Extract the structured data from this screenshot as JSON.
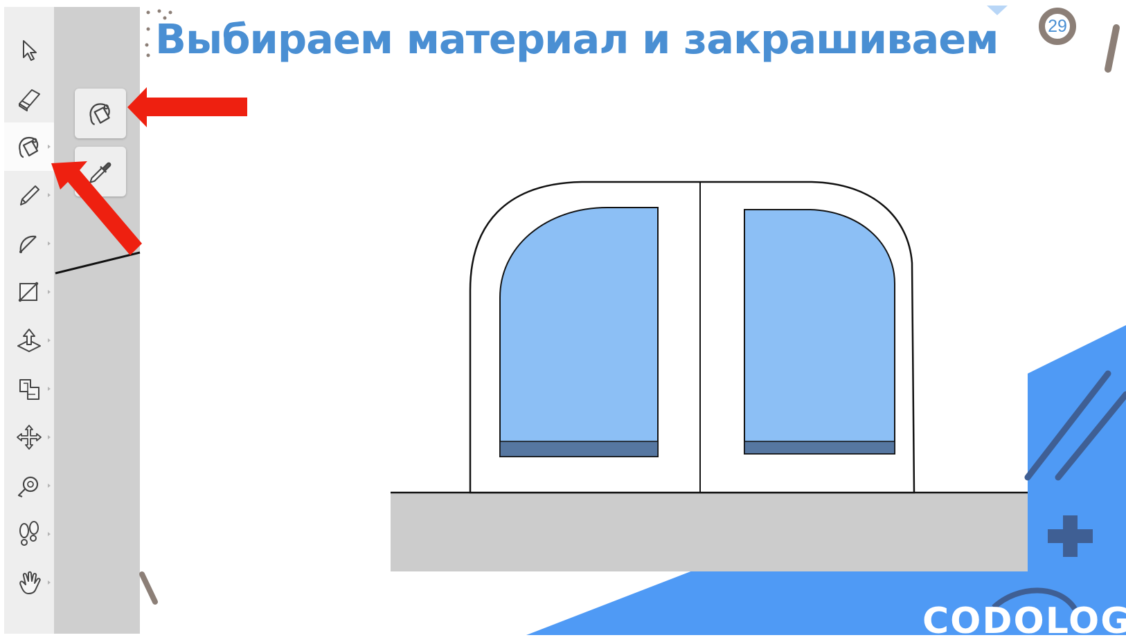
{
  "slide": {
    "title": "Выбираем материал и закрашиваем",
    "page_number": "29",
    "brand": "CODOLOGIA"
  },
  "toolbar": {
    "tools": [
      {
        "icon": "select-arrow-icon",
        "label": "Select"
      },
      {
        "icon": "eraser-icon",
        "label": "Eraser"
      },
      {
        "icon": "paint-bucket-icon",
        "label": "Paint Bucket",
        "active": true
      },
      {
        "icon": "pencil-icon",
        "label": "Line"
      },
      {
        "icon": "arc-icon",
        "label": "Arc"
      },
      {
        "icon": "rectangle-icon",
        "label": "Rectangle"
      },
      {
        "icon": "push-pull-icon",
        "label": "Push/Pull"
      },
      {
        "icon": "offset-icon",
        "label": "Offset"
      },
      {
        "icon": "move-icon",
        "label": "Move"
      },
      {
        "icon": "tape-measure-icon",
        "label": "Tape Measure"
      },
      {
        "icon": "footprints-icon",
        "label": "Walk"
      },
      {
        "icon": "hand-pan-icon",
        "label": "Pan"
      }
    ],
    "flyout": [
      {
        "icon": "paint-bucket-icon",
        "label": "Paint Bucket"
      },
      {
        "icon": "eyedropper-icon",
        "label": "Sample Paint"
      }
    ]
  },
  "colors": {
    "accent": "#4a8fd3",
    "glass": "#8cbff5",
    "glass_frame": "#5677a1",
    "ground": "#cccccc",
    "decor_blue": "#4f9af5",
    "arrow": "#ee2010"
  }
}
